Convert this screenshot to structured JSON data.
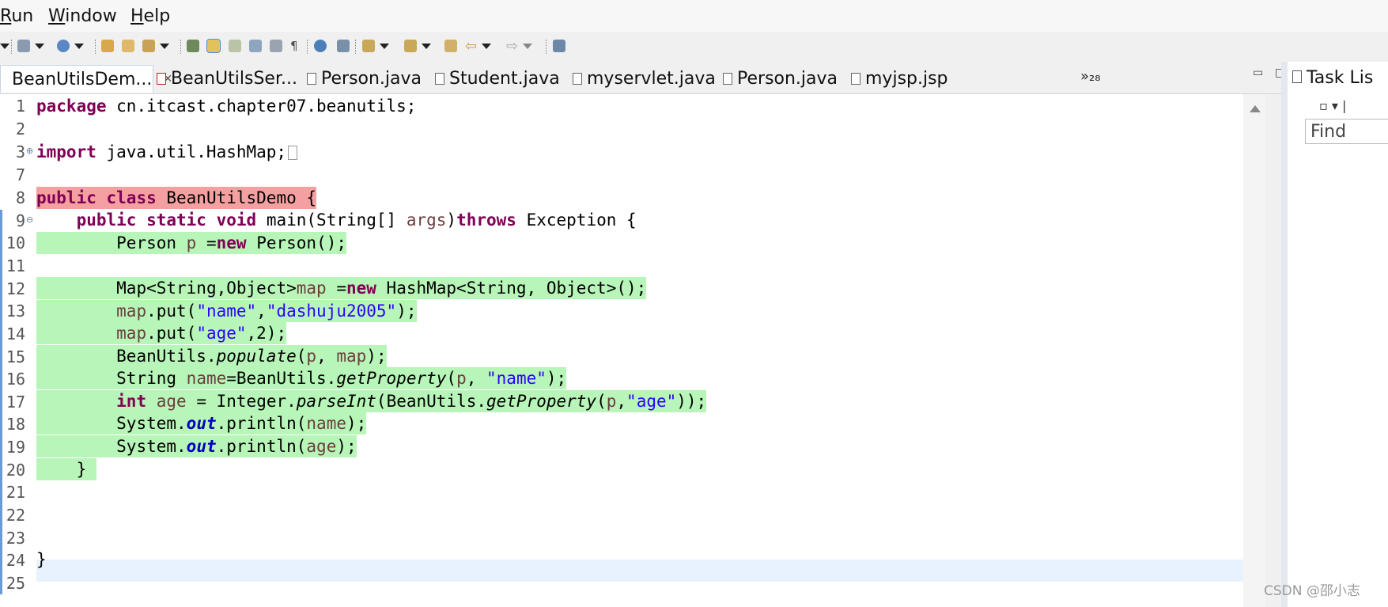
{
  "menu": {
    "run": "Run",
    "run_u": "R",
    "run_rest": "un",
    "window_u": "W",
    "window_rest": "indow",
    "help_u": "H",
    "help_rest": "elp"
  },
  "tabs": [
    {
      "label": "BeanUtilsDem...",
      "close": "✕",
      "active": true
    },
    {
      "label": "BeanUtilsSer..."
    },
    {
      "label": "Person.java"
    },
    {
      "label": "Student.java"
    },
    {
      "label": "myservlet.java"
    },
    {
      "label": "Person.java"
    },
    {
      "label": "myjsp.jsp"
    }
  ],
  "tab_overflow": "»₂₈",
  "right_panel": {
    "title": "Task Lis",
    "find_placeholder": "Find"
  },
  "watermark": "CSDN @邵小志",
  "line_numbers": [
    "1",
    "2",
    "3",
    "7",
    "8",
    "9",
    "10",
    "11",
    "12",
    "13",
    "14",
    "15",
    "16",
    "17",
    "18",
    "19",
    "20",
    "21",
    "22",
    "23",
    "24",
    "25"
  ],
  "code": {
    "l1_kw": "package",
    "l1_rest": " cn.itcast.chapter07.beanutils;",
    "l3_kw": "import",
    "l3_rest": " java.util.HashMap;",
    "l8_kw1": "public",
    "l8_kw2": "class",
    "l8_rest": " BeanUtilsDemo {",
    "l9_kw1": "public",
    "l9_kw2": "static",
    "l9_kw3": "void",
    "l9_a": " main(String[] ",
    "l9_var": "args",
    "l9_b": ")",
    "l9_kw4": "throws",
    "l9_c": " Exception {",
    "l10_a": "Person ",
    "l10_var": "p",
    "l10_b": " =",
    "l10_kw": "new",
    "l10_c": " Person();",
    "l12_a": "Map<String,Object>",
    "l12_var": "map",
    "l12_b": " =",
    "l12_kw": "new",
    "l12_c": " HashMap<String, Object>();",
    "l13_var": "map",
    "l13_a": ".put(",
    "l13_s1": "\"name\"",
    "l13_b": ",",
    "l13_s2": "\"dashuju2005\"",
    "l13_c": ");",
    "l14_var": "map",
    "l14_a": ".put(",
    "l14_s1": "\"age\"",
    "l14_b": ",2);",
    "l15_a": "BeanUtils.",
    "l15_it": "populate",
    "l15_b": "(",
    "l15_v1": "p",
    "l15_c": ", ",
    "l15_v2": "map",
    "l15_d": ");",
    "l16_a": "String ",
    "l16_v1": "name",
    "l16_b": "=BeanUtils.",
    "l16_it": "getProperty",
    "l16_c": "(",
    "l16_v2": "p",
    "l16_d": ", ",
    "l16_s": "\"name\"",
    "l16_e": ");",
    "l17_kw": "int",
    "l17_a": " ",
    "l17_v1": "age",
    "l17_b": " = Integer.",
    "l17_it1": "parseInt",
    "l17_c": "(BeanUtils.",
    "l17_it2": "getProperty",
    "l17_d": "(",
    "l17_v2": "p",
    "l17_e": ",",
    "l17_s": "\"age\"",
    "l17_f": "));",
    "l18_a": "System.",
    "l18_fld": "out",
    "l18_b": ".println(",
    "l18_var": "name",
    "l18_c": ");",
    "l19_a": "System.",
    "l19_fld": "out",
    "l19_b": ".println(",
    "l19_var": "age",
    "l19_c": ");",
    "l20": "}",
    "l24": "}"
  },
  "colors": {
    "keyword": "#7f0055",
    "string": "#2a00ff",
    "local_var": "#6a3e3e",
    "added": "#b8f5b8",
    "error": "#f5a0a0",
    "current_line": "#e8f2fe"
  }
}
